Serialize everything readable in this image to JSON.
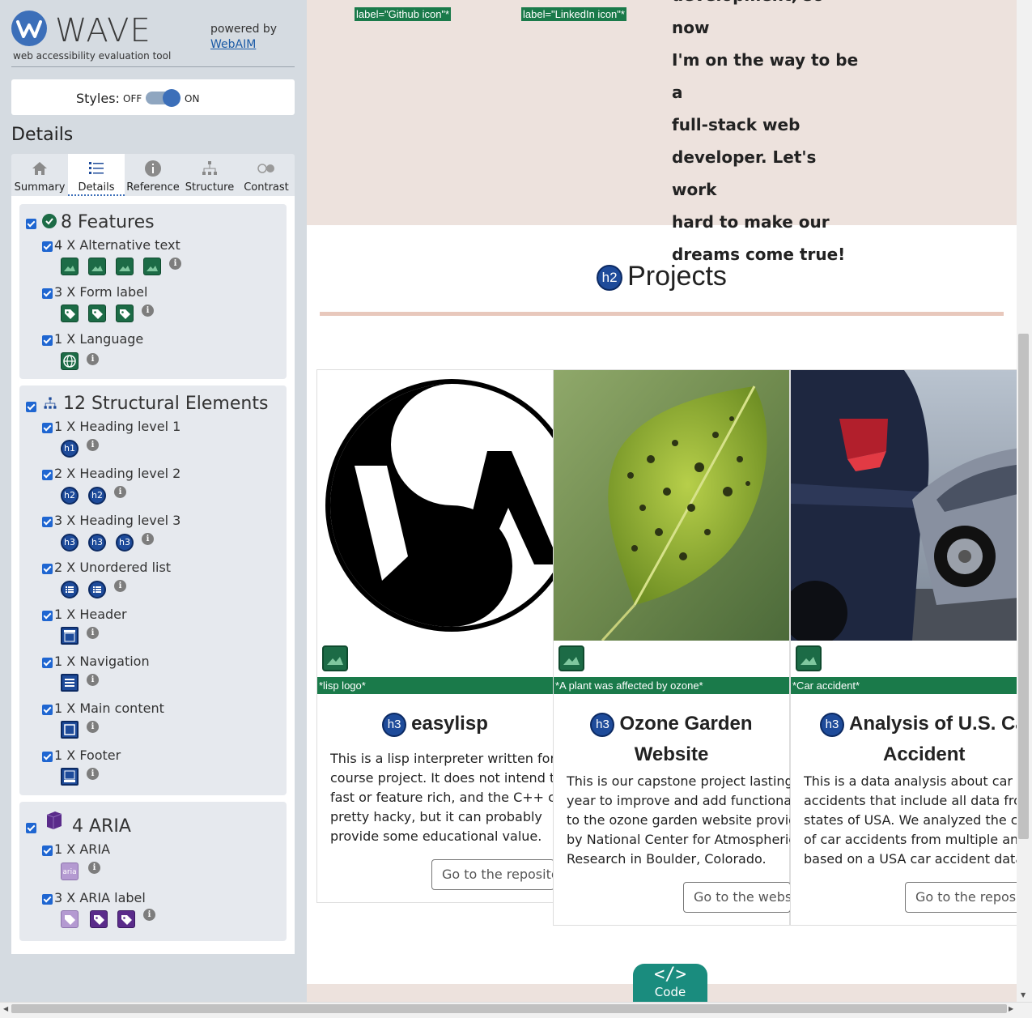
{
  "wave": {
    "logo_word": "WAVE",
    "tagline": "web accessibility evaluation tool",
    "powered_by": "powered by",
    "webaim_link": "WebAIM",
    "styles_label": "Styles:",
    "styles_off": "OFF",
    "styles_on": "ON",
    "details_heading": "Details",
    "tabs": [
      {
        "label": "Summary",
        "icon": "home-icon"
      },
      {
        "label": "Details",
        "icon": "list-icon",
        "active": true
      },
      {
        "label": "Reference",
        "icon": "info-icon"
      },
      {
        "label": "Structure",
        "icon": "sitemap-icon"
      },
      {
        "label": "Contrast",
        "icon": "contrast-icon"
      }
    ],
    "features": {
      "title": "8 Features",
      "items": [
        {
          "label": "4 X Alternative text",
          "count": 4
        },
        {
          "label": "3 X Form label",
          "count": 3
        },
        {
          "label": "1 X Language",
          "count": 1
        }
      ]
    },
    "structural": {
      "title": "12 Structural Elements",
      "items": [
        {
          "label": "1 X Heading level 1",
          "icon_text": "h1",
          "count": 1
        },
        {
          "label": "2 X Heading level 2",
          "icon_text": "h2",
          "count": 2
        },
        {
          "label": "3 X Heading level 3",
          "icon_text": "h3",
          "count": 3
        },
        {
          "label": "2 X Unordered list",
          "count": 2
        },
        {
          "label": "1 X Header",
          "count": 1
        },
        {
          "label": "1 X Navigation",
          "count": 1
        },
        {
          "label": "1 X Main content",
          "count": 1
        },
        {
          "label": "1 X Footer",
          "count": 1
        }
      ]
    },
    "aria": {
      "title": "4 ARIA",
      "items": [
        {
          "label": "1 X ARIA",
          "icon_text": "aria"
        },
        {
          "label": "3 X ARIA label"
        }
      ]
    },
    "colors": {
      "feature_green": "#1c6b46",
      "structure_blue": "#1e4b9a",
      "aria_purple": "#5a2b8a",
      "accent": "#3c6fb9"
    }
  },
  "page": {
    "github_label": "label=\"Github icon\"*",
    "linkedin_label": "label=\"LinkedIn icon\"*",
    "hero_text_lines": [
      "development, so now",
      "I'm on the way to be a",
      "full-stack web",
      "developer. Let's work",
      "hard to make our",
      "dreams come true!"
    ],
    "projects_heading": "Projects",
    "projects_badge": "h2",
    "cards": [
      {
        "alt": "*lisp logo*",
        "badge": "h3",
        "title_lines": [
          "easylisp"
        ],
        "body_lines": [
          "This is a lisp interpreter written for a",
          "course project. It does not intend to b",
          "fast or feature rich, and the C++ code",
          "pretty hacky, but it can probably",
          "provide some educational value."
        ],
        "button": "Go to the repository"
      },
      {
        "alt": "*A plant was affected by ozone*",
        "badge": "h3",
        "title_lines": [
          "Ozone Garden",
          "Website"
        ],
        "body_lines": [
          "This is our capstone project lasting fo",
          "year to improve and add functionaliti",
          "to the ozone garden website provide",
          "by National Center for Atmospheric",
          "Research in Boulder, Colorado."
        ],
        "button": "Go to the website"
      },
      {
        "alt": "*Car accident*",
        "badge": "h3",
        "title_lines": [
          "Analysis of U.S. Ca",
          "Accident"
        ],
        "body_lines": [
          "This is a data analysis about car",
          "accidents that include all data from",
          "states of USA. We analyzed the caus",
          "of car accidents from multiple angle",
          "based on a USA car accident dataset"
        ],
        "button": "Go to the repository"
      }
    ],
    "code_symbol": "</>",
    "code_label": "Code",
    "colors": {
      "hero_bg": "#ede2dd",
      "rule": "#e8c8bc",
      "alt_bar": "#1a7a4a",
      "code_tab": "#1a8c7e"
    }
  }
}
